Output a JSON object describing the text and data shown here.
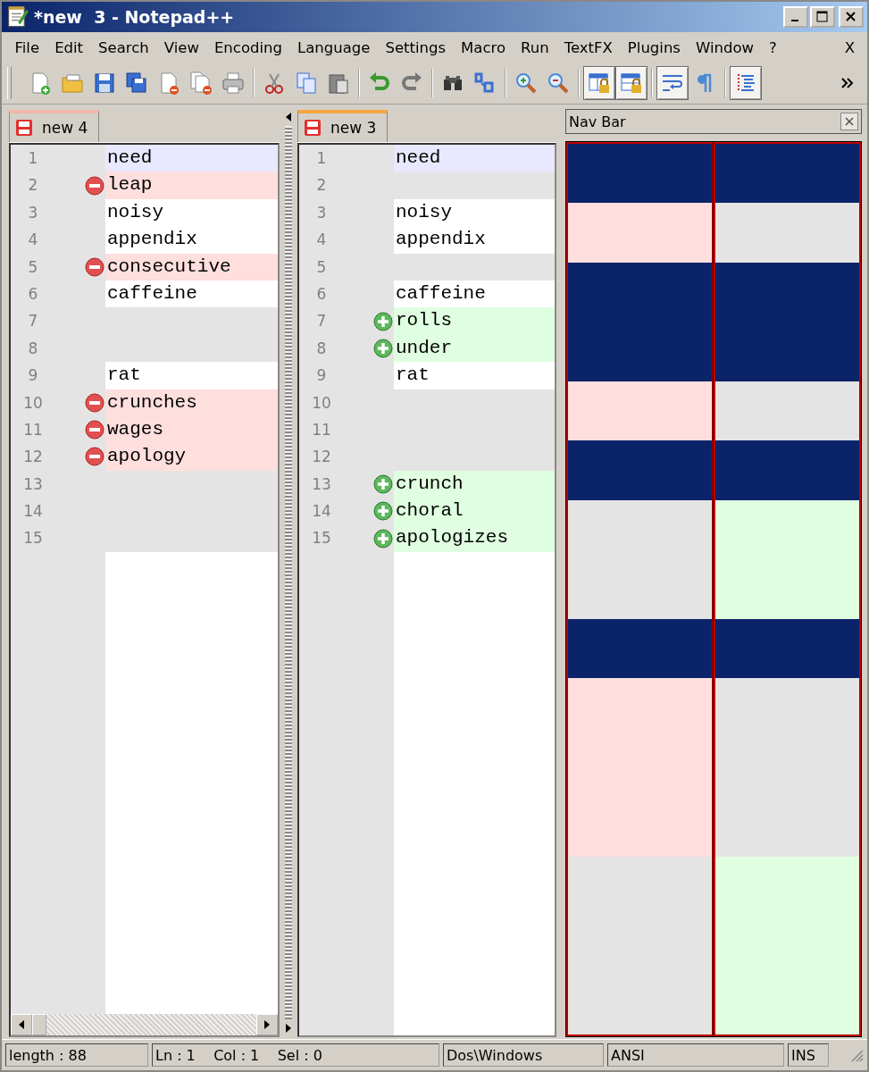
{
  "window": {
    "title": "*new  3 - Notepad++"
  },
  "menu": [
    "File",
    "Edit",
    "Search",
    "View",
    "Encoding",
    "Language",
    "Settings",
    "Macro",
    "Run",
    "TextFX",
    "Plugins",
    "Window",
    "?"
  ],
  "menu_close": "X",
  "toolbar": [
    {
      "kind": "new",
      "pressed": false
    },
    {
      "kind": "open",
      "pressed": false
    },
    {
      "kind": "save",
      "pressed": false
    },
    {
      "kind": "saveall",
      "pressed": false
    },
    {
      "kind": "close",
      "pressed": false
    },
    {
      "kind": "closeall",
      "pressed": false
    },
    {
      "kind": "print",
      "pressed": false
    },
    {
      "kind": "sep"
    },
    {
      "kind": "cut",
      "pressed": false
    },
    {
      "kind": "copy",
      "pressed": false
    },
    {
      "kind": "paste",
      "pressed": false
    },
    {
      "kind": "sep"
    },
    {
      "kind": "undo",
      "pressed": false
    },
    {
      "kind": "redo",
      "pressed": false
    },
    {
      "kind": "sep"
    },
    {
      "kind": "find",
      "pressed": false
    },
    {
      "kind": "replace",
      "pressed": false
    },
    {
      "kind": "sep"
    },
    {
      "kind": "zoomin",
      "pressed": false
    },
    {
      "kind": "zoomout",
      "pressed": false
    },
    {
      "kind": "sep"
    },
    {
      "kind": "lockv",
      "pressed": true
    },
    {
      "kind": "lockh",
      "pressed": true
    },
    {
      "kind": "sep"
    },
    {
      "kind": "wrap",
      "pressed": true
    },
    {
      "kind": "pilcrow",
      "pressed": false
    },
    {
      "kind": "sep"
    },
    {
      "kind": "indent",
      "pressed": true
    }
  ],
  "left_view": {
    "tab": {
      "label": "new 4",
      "focused": false
    },
    "rows": [
      {
        "num": "1",
        "text": "need",
        "kind": "same",
        "current": true
      },
      {
        "num": "2",
        "text": "leap",
        "kind": "deleted",
        "current": false
      },
      {
        "num": "3",
        "text": "noisy",
        "kind": "same",
        "current": false
      },
      {
        "num": "4",
        "text": "appendix",
        "kind": "same",
        "current": false
      },
      {
        "num": "5",
        "text": "consecutive",
        "kind": "deleted",
        "current": false
      },
      {
        "num": "6",
        "text": "caffeine",
        "kind": "same",
        "current": false
      },
      {
        "num": "7",
        "text": "",
        "kind": "blank",
        "current": false
      },
      {
        "num": "8",
        "text": "",
        "kind": "blank",
        "current": false
      },
      {
        "num": "9",
        "text": "rat",
        "kind": "same",
        "current": false
      },
      {
        "num": "10",
        "text": "crunches",
        "kind": "deleted",
        "current": false
      },
      {
        "num": "11",
        "text": "wages",
        "kind": "deleted",
        "current": false
      },
      {
        "num": "12",
        "text": "apology",
        "kind": "deleted",
        "current": false
      },
      {
        "num": "13",
        "text": "",
        "kind": "blank",
        "current": false
      },
      {
        "num": "14",
        "text": "",
        "kind": "blank",
        "current": false
      },
      {
        "num": "15",
        "text": "",
        "kind": "blank",
        "current": false
      }
    ]
  },
  "right_view": {
    "tab": {
      "label": "new 3",
      "focused": true
    },
    "rows": [
      {
        "num": "1",
        "text": "need",
        "kind": "same",
        "current": true
      },
      {
        "num": "2",
        "text": "",
        "kind": "blank",
        "current": false
      },
      {
        "num": "3",
        "text": "noisy",
        "kind": "same",
        "current": false
      },
      {
        "num": "4",
        "text": "appendix",
        "kind": "same",
        "current": false
      },
      {
        "num": "5",
        "text": "",
        "kind": "blank",
        "current": false
      },
      {
        "num": "6",
        "text": "caffeine",
        "kind": "same",
        "current": false
      },
      {
        "num": "7",
        "text": "rolls",
        "kind": "added",
        "current": false
      },
      {
        "num": "8",
        "text": "under",
        "kind": "added",
        "current": false
      },
      {
        "num": "9",
        "text": "rat",
        "kind": "same",
        "current": false
      },
      {
        "num": "10",
        "text": "",
        "kind": "blank",
        "current": false
      },
      {
        "num": "11",
        "text": "",
        "kind": "blank",
        "current": false
      },
      {
        "num": "12",
        "text": "",
        "kind": "blank",
        "current": false
      },
      {
        "num": "13",
        "text": "crunch",
        "kind": "added",
        "current": false
      },
      {
        "num": "14",
        "text": "choral",
        "kind": "added",
        "current": false
      },
      {
        "num": "15",
        "text": "apologizes",
        "kind": "added",
        "current": false
      }
    ]
  },
  "nav_bar": {
    "title": "Nav Bar"
  },
  "status_bar": {
    "length": "length : 88",
    "position": "Ln : 1    Col : 1    Sel : 0",
    "eol": "Dos\\Windows",
    "encoding": "ANSI",
    "mode": "INS"
  }
}
